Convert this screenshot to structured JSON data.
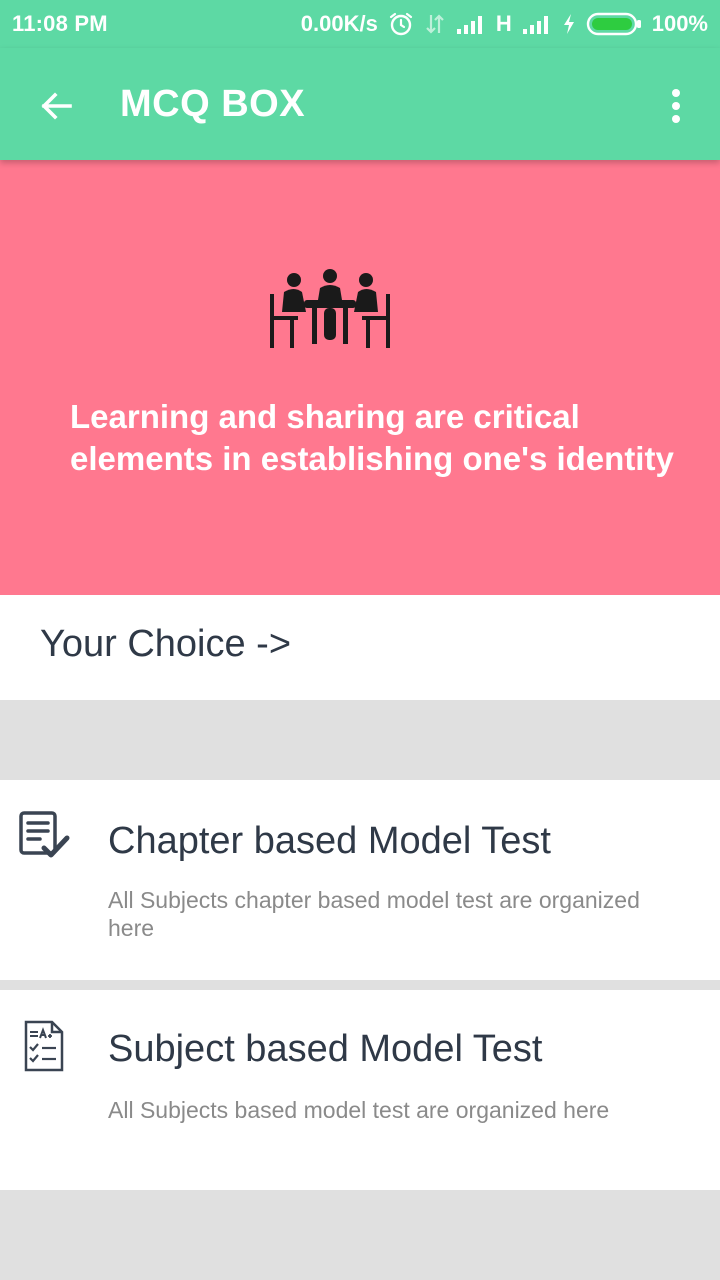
{
  "status_bar": {
    "time": "11:08 PM",
    "net_speed": "0.00K/s",
    "network_type": "H",
    "battery": "100%",
    "icons": [
      "alarm-icon",
      "data-transfer-icon",
      "signal-icon",
      "signal-icon",
      "charging-icon",
      "battery-icon"
    ]
  },
  "app_bar": {
    "title": "MCQ BOX",
    "back_icon": "arrow-left-icon",
    "menu_icon": "more-vert-icon"
  },
  "hero": {
    "icon": "meeting-table-icon",
    "quote": "Learning and sharing are critical elements in establishing one's identity"
  },
  "choice_label": "Your Choice ->",
  "cards": [
    {
      "icon": "checklist-icon",
      "title": "Chapter based Model Test",
      "description": "All Subjects chapter based model test are organized here"
    },
    {
      "icon": "quiz-sheet-icon",
      "title": "Subject based Model Test",
      "description": "All Subjects based model test are organized here"
    }
  ],
  "colors": {
    "primary": "#5dd9a4",
    "hero": "#ff788f",
    "text_dark": "#2f3947",
    "text_muted": "#8a8a8a",
    "background": "#e0e0e0"
  }
}
